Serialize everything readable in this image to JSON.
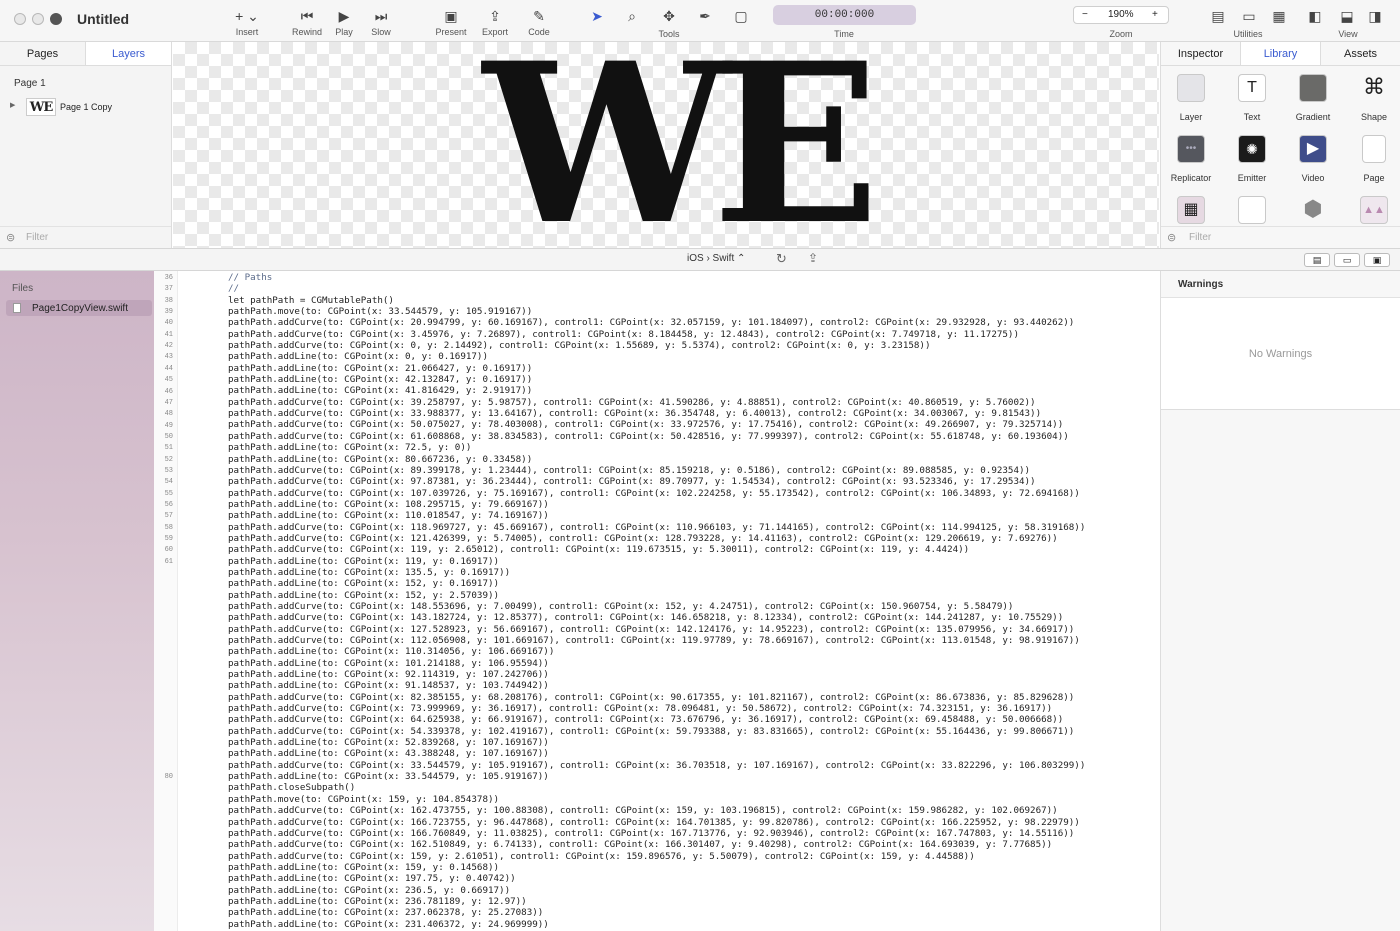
{
  "window": {
    "title": "Untitled"
  },
  "toolbar": {
    "insert": "Insert",
    "rewind": "Rewind",
    "play": "Play",
    "slow": "Slow",
    "present": "Present",
    "export": "Export",
    "code": "Code",
    "tools": "Tools",
    "time_value": "00:00:000",
    "time_label": "Time",
    "zoom_value": "190%",
    "zoom_label": "Zoom",
    "zoom_minus": "−",
    "zoom_plus": "+",
    "utilities": "Utilities",
    "view": "View"
  },
  "left_panel": {
    "tab_pages": "Pages",
    "tab_layers": "Layers",
    "page_heading": "Page 1",
    "layer_thumb": "WE",
    "layer_name": "Page 1 Copy",
    "filter_placeholder": "Filter"
  },
  "canvas": {
    "text": "WE"
  },
  "right_panel": {
    "tab_inspector": "Inspector",
    "tab_library": "Library",
    "tab_assets": "Assets",
    "items": [
      {
        "label": "Layer",
        "icon": "layer-icon"
      },
      {
        "label": "Text",
        "icon": "text-icon"
      },
      {
        "label": "Gradient",
        "icon": "gradient-icon"
      },
      {
        "label": "Shape",
        "icon": "shape-icon"
      },
      {
        "label": "Replicator",
        "icon": "replicator-icon"
      },
      {
        "label": "Emitter",
        "icon": "emitter-icon"
      },
      {
        "label": "Video",
        "icon": "video-icon"
      },
      {
        "label": "Page",
        "icon": "page-icon"
      }
    ],
    "filter_placeholder": "Filter"
  },
  "code_bar": {
    "platform": "iOS › Swift ⌃"
  },
  "files": {
    "heading": "Files",
    "file": "Page1CopyView.swift"
  },
  "warnings": {
    "title": "Warnings",
    "empty": "No Warnings"
  },
  "gutter_numbers": [
    "36",
    "37",
    "38",
    "39",
    "40",
    "41",
    "42",
    "43",
    "44",
    "45",
    "46",
    "47",
    "48",
    "49",
    "50",
    "51",
    "52",
    "53",
    "54",
    "55",
    "56",
    "57",
    "58",
    "59",
    "60",
    "61",
    "80"
  ],
  "code_lines": [
    "// Paths",
    "//",
    "let pathPath = CGMutablePath()",
    "pathPath.move(to: CGPoint(x: 33.544579, y: 105.919167))",
    "pathPath.addCurve(to: CGPoint(x: 20.994799, y: 60.169167), control1: CGPoint(x: 32.057159, y: 101.184097), control2: CGPoint(x: 29.932928, y: 93.440262))",
    "pathPath.addCurve(to: CGPoint(x: 3.45976, y: 7.26897), control1: CGPoint(x: 8.184458, y: 12.4843), control2: CGPoint(x: 7.749718, y: 11.17275))",
    "pathPath.addCurve(to: CGPoint(x: 0, y: 2.14492), control1: CGPoint(x: 1.55689, y: 5.5374), control2: CGPoint(x: 0, y: 3.23158))",
    "pathPath.addLine(to: CGPoint(x: 0, y: 0.16917))",
    "pathPath.addLine(to: CGPoint(x: 21.066427, y: 0.16917))",
    "pathPath.addLine(to: CGPoint(x: 42.132847, y: 0.16917))",
    "pathPath.addLine(to: CGPoint(x: 41.816429, y: 2.91917))",
    "pathPath.addCurve(to: CGPoint(x: 39.258797, y: 5.98757), control1: CGPoint(x: 41.590286, y: 4.88851), control2: CGPoint(x: 40.860519, y: 5.76002))",
    "pathPath.addCurve(to: CGPoint(x: 33.988377, y: 13.64167), control1: CGPoint(x: 36.354748, y: 6.40013), control2: CGPoint(x: 34.003067, y: 9.81543))",
    "pathPath.addCurve(to: CGPoint(x: 50.075027, y: 78.403008), control1: CGPoint(x: 33.972576, y: 17.75416), control2: CGPoint(x: 49.266907, y: 79.325714))",
    "pathPath.addCurve(to: CGPoint(x: 61.608868, y: 38.834583), control1: CGPoint(x: 50.428516, y: 77.999397), control2: CGPoint(x: 55.618748, y: 60.193604))",
    "pathPath.addLine(to: CGPoint(x: 72.5, y: 0))",
    "pathPath.addLine(to: CGPoint(x: 80.667236, y: 0.33458))",
    "pathPath.addCurve(to: CGPoint(x: 89.399178, y: 1.23444), control1: CGPoint(x: 85.159218, y: 0.5186), control2: CGPoint(x: 89.088585, y: 0.92354))",
    "pathPath.addCurve(to: CGPoint(x: 97.87381, y: 36.23444), control1: CGPoint(x: 89.70977, y: 1.54534), control2: CGPoint(x: 93.523346, y: 17.29534))",
    "pathPath.addCurve(to: CGPoint(x: 107.039726, y: 75.169167), control1: CGPoint(x: 102.224258, y: 55.173542), control2: CGPoint(x: 106.34893, y: 72.694168))",
    "pathPath.addLine(to: CGPoint(x: 108.295715, y: 79.669167))",
    "pathPath.addLine(to: CGPoint(x: 110.018547, y: 74.169167))",
    "pathPath.addCurve(to: CGPoint(x: 118.969727, y: 45.669167), control1: CGPoint(x: 110.966103, y: 71.144165), control2: CGPoint(x: 114.994125, y: 58.319168))",
    "pathPath.addCurve(to: CGPoint(x: 121.426399, y: 5.74005), control1: CGPoint(x: 128.793228, y: 14.41163), control2: CGPoint(x: 129.206619, y: 7.69276))",
    "pathPath.addCurve(to: CGPoint(x: 119, y: 2.65012), control1: CGPoint(x: 119.673515, y: 5.30011), control2: CGPoint(x: 119, y: 4.4424))",
    "pathPath.addLine(to: CGPoint(x: 119, y: 0.16917))",
    "pathPath.addLine(to: CGPoint(x: 135.5, y: 0.16917))",
    "pathPath.addLine(to: CGPoint(x: 152, y: 0.16917))",
    "pathPath.addLine(to: CGPoint(x: 152, y: 2.57039))",
    "pathPath.addCurve(to: CGPoint(x: 148.553696, y: 7.00499), control1: CGPoint(x: 152, y: 4.24751), control2: CGPoint(x: 150.960754, y: 5.58479))",
    "pathPath.addCurve(to: CGPoint(x: 143.182724, y: 12.85377), control1: CGPoint(x: 146.658218, y: 8.12334), control2: CGPoint(x: 144.241287, y: 10.75529))",
    "pathPath.addCurve(to: CGPoint(x: 127.528923, y: 56.669167), control1: CGPoint(x: 142.124176, y: 14.95223), control2: CGPoint(x: 135.079956, y: 34.66917))",
    "pathPath.addCurve(to: CGPoint(x: 112.056908, y: 101.669167), control1: CGPoint(x: 119.97789, y: 78.669167), control2: CGPoint(x: 113.01548, y: 98.919167))",
    "pathPath.addLine(to: CGPoint(x: 110.314056, y: 106.669167))",
    "pathPath.addLine(to: CGPoint(x: 101.214188, y: 106.95594))",
    "pathPath.addLine(to: CGPoint(x: 92.114319, y: 107.242706))",
    "pathPath.addLine(to: CGPoint(x: 91.148537, y: 103.744942))",
    "pathPath.addCurve(to: CGPoint(x: 82.385155, y: 68.208176), control1: CGPoint(x: 90.617355, y: 101.821167), control2: CGPoint(x: 86.673836, y: 85.829628))",
    "pathPath.addCurve(to: CGPoint(x: 73.999969, y: 36.16917), control1: CGPoint(x: 78.096481, y: 50.58672), control2: CGPoint(x: 74.323151, y: 36.16917))",
    "pathPath.addCurve(to: CGPoint(x: 64.625938, y: 66.919167), control1: CGPoint(x: 73.676796, y: 36.16917), control2: CGPoint(x: 69.458488, y: 50.006668))",
    "pathPath.addCurve(to: CGPoint(x: 54.339378, y: 102.419167), control1: CGPoint(x: 59.793388, y: 83.831665), control2: CGPoint(x: 55.164436, y: 99.806671))",
    "pathPath.addLine(to: CGPoint(x: 52.839268, y: 107.169167))",
    "pathPath.addLine(to: CGPoint(x: 43.388248, y: 107.169167))",
    "pathPath.addCurve(to: CGPoint(x: 33.544579, y: 105.919167), control1: CGPoint(x: 36.703518, y: 107.169167), control2: CGPoint(x: 33.822296, y: 106.803299))",
    "pathPath.addLine(to: CGPoint(x: 33.544579, y: 105.919167))",
    "pathPath.closeSubpath()",
    "pathPath.move(to: CGPoint(x: 159, y: 104.854378))",
    "pathPath.addCurve(to: CGPoint(x: 162.473755, y: 100.88308), control1: CGPoint(x: 159, y: 103.196815), control2: CGPoint(x: 159.986282, y: 102.069267))",
    "pathPath.addCurve(to: CGPoint(x: 166.723755, y: 96.447868), control1: CGPoint(x: 164.701385, y: 99.820786), control2: CGPoint(x: 166.225952, y: 98.22979))",
    "pathPath.addCurve(to: CGPoint(x: 166.760849, y: 11.03825), control1: CGPoint(x: 167.713776, y: 92.903946), control2: CGPoint(x: 167.747803, y: 14.55116))",
    "pathPath.addCurve(to: CGPoint(x: 162.510849, y: 6.74133), control1: CGPoint(x: 166.301407, y: 9.40298), control2: CGPoint(x: 164.693039, y: 7.77685))",
    "pathPath.addCurve(to: CGPoint(x: 159, y: 2.61051), control1: CGPoint(x: 159.896576, y: 5.50079), control2: CGPoint(x: 159, y: 4.44588))",
    "pathPath.addLine(to: CGPoint(x: 159, y: 0.14568))",
    "pathPath.addLine(to: CGPoint(x: 197.75, y: 0.40742))",
    "pathPath.addLine(to: CGPoint(x: 236.5, y: 0.66917))",
    "pathPath.addLine(to: CGPoint(x: 236.781189, y: 12.97))",
    "pathPath.addLine(to: CGPoint(x: 237.062378, y: 25.27083))",
    "pathPath.addLine(to: CGPoint(x: 231.406372, y: 24.969999))"
  ]
}
